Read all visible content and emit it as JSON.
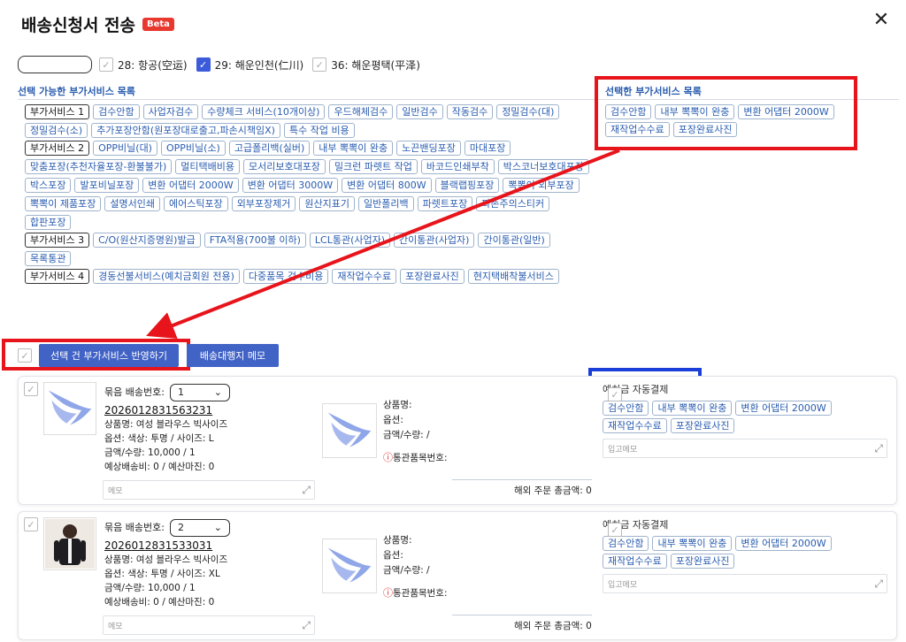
{
  "header": {
    "title": "배송신청서 전송",
    "beta": "Beta",
    "close": "✕"
  },
  "ports": [
    {
      "label": "28: 항공(空运)",
      "checked": false
    },
    {
      "label": "29: 해운인천(仁川)",
      "checked": true
    },
    {
      "label": "36: 해운평택(平泽)",
      "checked": false
    }
  ],
  "available": {
    "title": "선택 가능한 부가서비스 목록",
    "groups": [
      {
        "category": "부가서비스 1",
        "tags": [
          "검수안함",
          "사업자검수",
          "수량체크 서비스(10개이상)",
          "우드해체검수",
          "일반검수",
          "작동검수",
          "정밀검수(대)",
          "정밀검수(소)",
          "추가포장안함(원포장대로출고,파손시책임X)",
          "특수 작업 비용"
        ]
      },
      {
        "category": "부가서비스 2",
        "tags": [
          "OPP비닐(대)",
          "OPP비닐(소)",
          "고급폴리백(실버)",
          "내부 뽁뽁이 완충",
          "노끈밴딩포장",
          "마대포장",
          "맞춤포장(추천자율포장-환불불가)",
          "멀티택배비용",
          "모서리보호대포장",
          "밀크런 파렛트 작업",
          "바코드인쇄부착",
          "박스코너보호대포장",
          "박스포장",
          "발포비닐포장",
          "변환 어댑터 2000W",
          "변환 어댑터 3000W",
          "변환 어댑터 800W",
          "블랙랩핑포장",
          "뽁뽁이 외부포장",
          "뽁뽁이 제품포장",
          "설명서인쇄",
          "에어스틱포장",
          "외부포장제거",
          "원산지표기",
          "일반폴리백",
          "파렛트포장",
          "파손주의스티커",
          "합판포장"
        ]
      },
      {
        "category": "부가서비스 3",
        "tags": [
          "C/O(원산지증명원)발급",
          "FTA적용(700불 이하)",
          "LCL통관(사업자)",
          "간이통관(사업자)",
          "간이통관(일반)",
          "목록통관"
        ]
      },
      {
        "category": "부가서비스 4",
        "tags": [
          "경동선불서비스(예치금회원 전용)",
          "다중품목 검수비용",
          "재작업수수료",
          "포장완료사진",
          "현지택배착불서비스"
        ]
      }
    ]
  },
  "selected": {
    "title": "선택한 부가서비스 목록",
    "tags": [
      "검수안함",
      "내부 뽁뽁이 완충",
      "변환 어댑터 2000W",
      "재작업수수료",
      "포장완료사진"
    ]
  },
  "actions": {
    "apply": "선택 건 부가서비스 반영하기",
    "memo": "배송대행지 메모"
  },
  "orders": [
    {
      "bundle_label": "묶음 배송번호:",
      "bundle_value": "1",
      "order_no": "2026012831563231",
      "product": "상품명: 여성 블라우스 빅사이즈",
      "option": "옵션: 색상: 투명 / 사이즈: L",
      "amount": "금액/수량: 10,000 / 1",
      "shipping": "예상배송비: 0 / 예산마진: 0",
      "memo_placeholder": "메모",
      "p2_name": "상품명:",
      "p2_option": "옵션:",
      "p2_amount": "금액/수량:  /",
      "customs": "통관품목번호:",
      "total": "해외 주문 총금액: 0",
      "auto_pay": "예치금 자동결제",
      "tags": [
        "검수안함",
        "내부 뽁뽁이 완충",
        "변환 어댑터 2000W",
        "재작업수수료",
        "포장완료사진"
      ],
      "in_memo": "입고메모",
      "thumb": "bird"
    },
    {
      "bundle_label": "묶음 배송번호:",
      "bundle_value": "2",
      "order_no": "2026012831533031",
      "product": "상품명: 여성 블라우스 빅사이즈",
      "option": "옵션: 색상: 투명 / 사이즈: XL",
      "amount": "금액/수량: 10,000 / 1",
      "shipping": "예상배송비: 0 / 예산마진: 0",
      "memo_placeholder": "메모",
      "p2_name": "상품명:",
      "p2_option": "옵션:",
      "p2_amount": "금액/수량:  /",
      "customs": "통관품목번호:",
      "total": "해외 주문 총금액: 0",
      "auto_pay": "예치금 자동결제",
      "tags": [
        "검수안함",
        "내부 뽁뽁이 완충",
        "변환 어댑터 2000W",
        "재작업수수료",
        "포장완료사진"
      ],
      "in_memo": "입고메모",
      "thumb": "photo"
    }
  ],
  "colors": {
    "accent": "#3b5bdb",
    "tag_text": "#2a5db0",
    "red_highlight": "#e8141b",
    "blue_highlight": "#1a3ed8"
  }
}
